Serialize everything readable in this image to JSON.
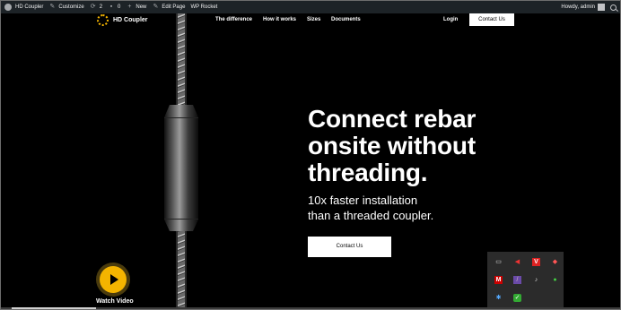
{
  "admin_bar": {
    "site_name": "HD Coupler",
    "customize": "Customize",
    "updates_count": "2",
    "comments_count": "0",
    "new_label": "New",
    "edit_page": "Edit Page",
    "wp_rocket": "WP Rocket",
    "howdy": "Howdy, admin"
  },
  "header": {
    "logo_text": "HD Coupler",
    "nav": [
      "The difference",
      "How it works",
      "Sizes",
      "Documents"
    ],
    "login": "Login",
    "contact_button": "Contact Us"
  },
  "hero": {
    "headline": [
      "Connect rebar",
      "onsite without",
      "threading."
    ],
    "subhead": [
      "10x faster installation",
      "than a threaded coupler."
    ],
    "cta": "Contact Us",
    "watch_video": "Watch Video"
  },
  "colors": {
    "accent": "#f4b400",
    "admin_bar_bg": "#1d2327",
    "page_bg": "#000000",
    "tray_bg": "#2b2b2b"
  },
  "tray_icons": [
    "network-icon",
    "arrow-icon",
    "antivirus-v-icon",
    "shield-icon",
    "mcafee-icon",
    "feather-icon",
    "volume-icon",
    "vpn-icon",
    "bluetooth-icon",
    "security-check-icon"
  ]
}
